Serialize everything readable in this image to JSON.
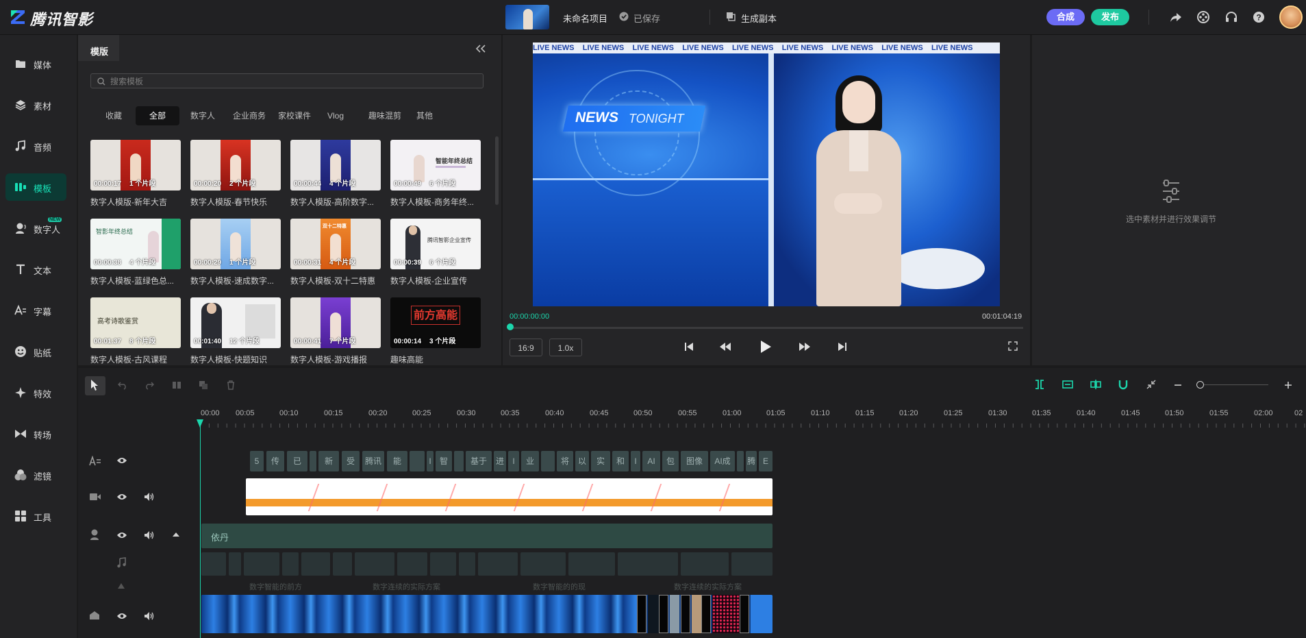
{
  "app": {
    "name": "腾讯智影",
    "project_name": "未命名项目",
    "saved_status": "已保存",
    "generate_copy": "生成副本",
    "compose_btn": "合成",
    "publish_btn": "发布"
  },
  "colors": {
    "accent": "#1cd6ac",
    "compose": "#6b6bf5",
    "publish": "#1ec9a0",
    "active_bg": "#0c3a34"
  },
  "sidebar": {
    "items": [
      {
        "label": "媒体",
        "icon": "media-icon"
      },
      {
        "label": "素材",
        "icon": "layers-icon"
      },
      {
        "label": "音频",
        "icon": "music-note-icon"
      },
      {
        "label": "模板",
        "icon": "template-icon",
        "active": true
      },
      {
        "label": "数字人",
        "icon": "digital-human-icon",
        "badge": "NEW"
      },
      {
        "label": "文本",
        "icon": "text-icon"
      },
      {
        "label": "字幕",
        "icon": "subtitle-icon"
      },
      {
        "label": "贴纸",
        "icon": "sticker-icon"
      },
      {
        "label": "特效",
        "icon": "sparkle-icon"
      },
      {
        "label": "转场",
        "icon": "transition-icon"
      },
      {
        "label": "滤镜",
        "icon": "filter-icon"
      },
      {
        "label": "工具",
        "icon": "tools-icon"
      }
    ]
  },
  "template_panel": {
    "tab": "模版",
    "search_placeholder": "搜索模板",
    "categories": [
      "收藏",
      "全部",
      "数字人",
      "企业商务",
      "家校课件",
      "Vlog",
      "趣味混剪",
      "其他"
    ],
    "active_category": "全部",
    "cards": [
      {
        "duration": "00:00:17",
        "segments": "1 个片段",
        "title": "数字人模版-新年大吉"
      },
      {
        "duration": "00:00:20",
        "segments": "2 个片段",
        "title": "数字人模版-春节快乐"
      },
      {
        "duration": "00:00:44",
        "segments": "4 个片段",
        "title": "数字人模版-高阶数字..."
      },
      {
        "duration": "00:00:49",
        "segments": "6 个片段",
        "title": "数字人模板-商务年终..."
      },
      {
        "duration": "00:00:38",
        "segments": "4 个片段",
        "title": "数字人模板-蓝绿色总..."
      },
      {
        "duration": "00:00:29",
        "segments": "1 个片段",
        "title": "数字人模板-速成数字..."
      },
      {
        "duration": "00:00:31",
        "segments": "4 个片段",
        "title": "数字人模板-双十二特惠"
      },
      {
        "duration": "00:00:39",
        "segments": "6 个片段",
        "title": "数字人模板-企业宣传"
      },
      {
        "duration": "00:01:37",
        "segments": "8 个片段",
        "title": "数字人模板-古风课程"
      },
      {
        "duration": "00:01:40",
        "segments": "12 个片段",
        "title": "数字人模板-快题知识"
      },
      {
        "duration": "00:00:41",
        "segments": "7 个片段",
        "title": "数字人模板-游戏播报"
      },
      {
        "duration": "00:00:14",
        "segments": "3 个片段",
        "title": "趣味高能"
      }
    ],
    "card_overlays": {
      "c3_text": "智能年终总结",
      "c4_text": "智影年终总结",
      "c6_text": "双十二特惠",
      "c7_text": "腾讯智影企业宣传",
      "c8_text": "高考诗歌鉴赏",
      "c11_text": "前方高能"
    }
  },
  "preview": {
    "ticker_text": "LIVE NEWS",
    "news_logo_1": "NEWS",
    "news_logo_2": "TONIGHT",
    "current_time": "00:00:00:00",
    "total_time": "00:01:04:19",
    "aspect_ratio": "16:9",
    "speed": "1.0x"
  },
  "right_panel": {
    "hint": "选中素材并进行效果调节"
  },
  "timeline": {
    "ruler": [
      "00:00",
      "00:05",
      "00:10",
      "00:15",
      "00:20",
      "00:25",
      "00:30",
      "00:35",
      "00:40",
      "00:45",
      "00:50",
      "00:55",
      "01:00",
      "01:05",
      "01:10",
      "01:15",
      "01:20",
      "01:25",
      "01:30",
      "01:35",
      "01:40",
      "01:45",
      "01:50",
      "01:55",
      "02:00",
      "02"
    ],
    "text_clips": [
      "5",
      "传",
      "已",
      "",
      "新",
      "受",
      "腾讯",
      "能",
      "",
      "I",
      "智",
      "",
      "基于",
      "进",
      "I",
      "业",
      "",
      "将",
      "以",
      "实",
      "和",
      "I",
      "AI",
      "包",
      "图像",
      "AI成",
      "",
      "腾",
      "E"
    ],
    "digital_human_name": "依丹",
    "faint_labels": [
      "数字智能的前方",
      "数字连续的实际方案",
      "数字智能的的现",
      "数字连续的实际方案"
    ]
  }
}
